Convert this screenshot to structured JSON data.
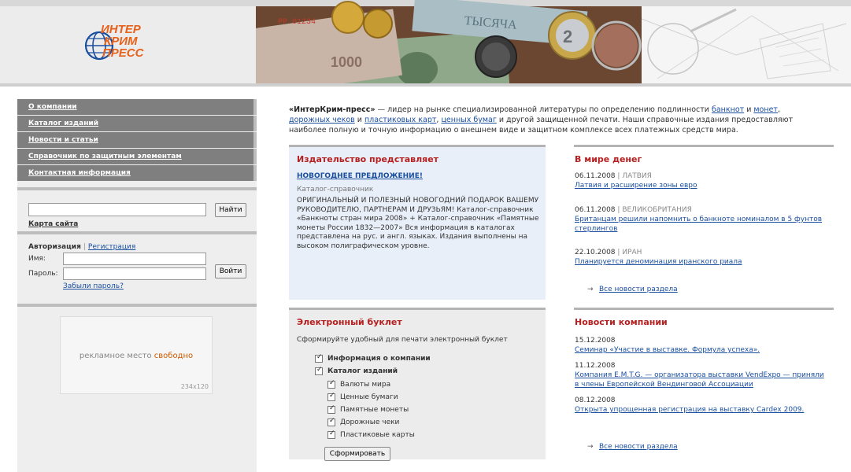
{
  "header": {
    "logo_lines": [
      "ИНТЕР",
      "КРИМ",
      "ПРЕСС"
    ],
    "banner_note_text": "ТЫСЯЧА"
  },
  "sidebar": {
    "nav": [
      {
        "label": "О компании"
      },
      {
        "label": "Каталог изданий"
      },
      {
        "label": "Новости и статьи"
      },
      {
        "label": "Справочник по защитным элементам"
      },
      {
        "label": "Контактная информация"
      }
    ],
    "search": {
      "button": "Найти",
      "sitemap": "Карта сайта",
      "value": ""
    },
    "auth": {
      "title": "Авторизация",
      "register": "Регистрация",
      "name_label": "Имя:",
      "password_label": "Пароль:",
      "login_button": "Войти",
      "forgot": "Забыли пароль?"
    },
    "ad": {
      "text_prefix": "рекламное место",
      "text_free": "свободно",
      "size": "234x120"
    }
  },
  "intro": {
    "brand": "«ИнтерКрим-пресс»",
    "t1": " — лидер на рынке специализированной литературы по определению подлинности ",
    "l1": "банкнот",
    "t2": " и ",
    "l2": "монет",
    "t3": ", ",
    "l3": "дорожных чеков",
    "t4": " и ",
    "l4": "пластиковых карт",
    "t5": ", ",
    "l5": "ценных бумаг",
    "t6": " и другой защищенной печати. Наши справочные издания предоставляют наиболее полную и точную информацию о внешнем виде и защитном комплексе всех платежных средств мира."
  },
  "publisher": {
    "title": "Издательство представляет",
    "link": "НОВОГОДНЕЕ ПРЕДЛОЖЕНИЕ!",
    "subtitle": "Каталог-справочник",
    "body": "ОРИГИНАЛЬНЫЙ И ПОЛЕЗНЫЙ НОВОГОДНИЙ ПОДАРОК ВАШЕМУ РУКОВОДИТЕЛЮ, ПАРТНЕРАМ И ДРУЗЬЯМ! Каталог-справочник «Банкноты стран мира 2008» + Каталог-справочник «Памятные монеты России 1832—2007» Вся информация в каталогах представлена на рус. и англ. языках. Издания выполнены на высоком полиграфическом уровне."
  },
  "money_news": {
    "title": "В мире денег",
    "items": [
      {
        "date": "06.11.2008",
        "place": "ЛАТВИЯ",
        "text": "Латвия и расширение зоны евро"
      },
      {
        "date": "06.11.2008",
        "place": "ВЕЛИКОБРИТАНИЯ",
        "text": "Британцам решили напомнить о банкноте номиналом в 5 фунтов стерлингов"
      },
      {
        "date": "22.10.2008",
        "place": "ИРАН",
        "text": "Планируется деноминация иранского риала"
      }
    ],
    "all": "Все новости раздела"
  },
  "booklet": {
    "title": "Электронный буклет",
    "desc": "Сформируйте удобный для печати электронный буклет",
    "options": [
      {
        "label": "Информация о компании"
      },
      {
        "label": "Каталог изданий"
      },
      {
        "label": "Валюты мира"
      },
      {
        "label": "Ценные бумаги"
      },
      {
        "label": "Памятные монеты"
      },
      {
        "label": "Дорожные чеки"
      },
      {
        "label": "Пластиковые карты"
      }
    ],
    "button": "Сформировать"
  },
  "company_news": {
    "title": "Новости компании",
    "items": [
      {
        "date": "15.12.2008",
        "text": "Семинар «Участие в выставке. Формула успеха»."
      },
      {
        "date": "11.12.2008",
        "text": "Компания E.M.T.G. — организатора выставки VendExpo — приняли в члены Европейской Вендинговой Ассоциации"
      },
      {
        "date": "08.12.2008",
        "text": "Открыта упрощенная регистрация на выставку Cardex 2009."
      }
    ],
    "all": "Все новости раздела"
  },
  "colors": {
    "accent_red": "#b52020",
    "link_blue": "#1a4fa0",
    "nav_gray": "#7f7f7f",
    "logo_orange": "#e8611a",
    "logo_blue": "#1a4fa0"
  }
}
